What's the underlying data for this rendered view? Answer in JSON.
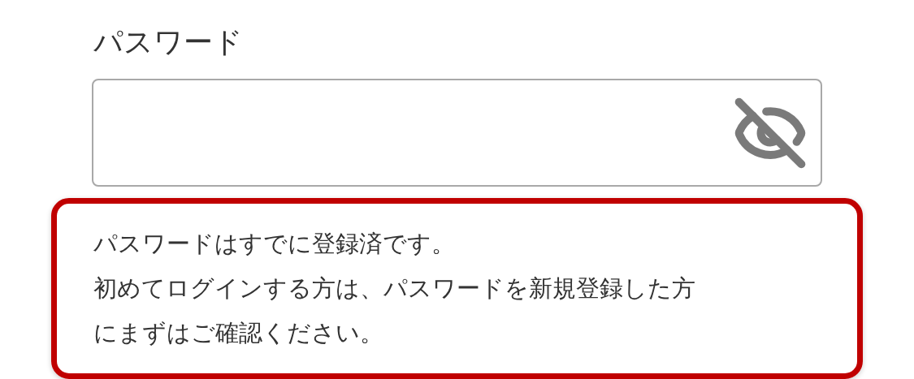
{
  "password_field": {
    "label": "パスワード",
    "password_visible": false
  },
  "notice": {
    "lines": [
      "パスワードはすでに登録済です。",
      "初めてログインする方は、パスワードを新規登録した方",
      "にまずはご確認ください。"
    ]
  }
}
